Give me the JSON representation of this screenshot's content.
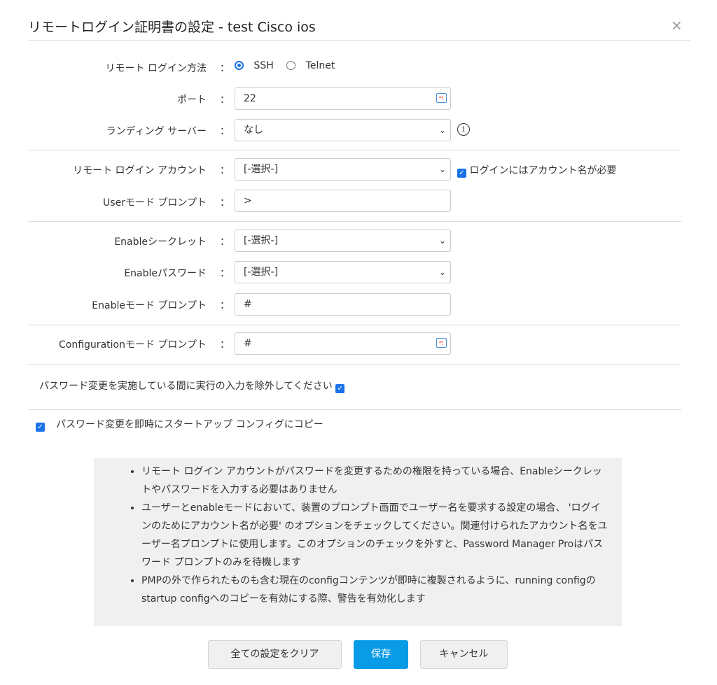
{
  "title": "リモートログイン証明書の設定 - test Cisco ios",
  "close": "×",
  "colon": "：",
  "fields": {
    "login_method": {
      "label": "リモート ログイン方法",
      "options": [
        "SSH",
        "Telnet"
      ],
      "selected": "SSH"
    },
    "port": {
      "label": "ポート",
      "value": "22"
    },
    "landing": {
      "label": "ランディング サーバー",
      "value": "なし"
    },
    "account": {
      "label": "リモート ログイン アカウント",
      "value": "[-選択-]",
      "check_label": "ログインにはアカウント名が必要",
      "checked": true
    },
    "user_prompt": {
      "label": "Userモード プロンプト",
      "value": ">"
    },
    "secret": {
      "label": "Enableシークレット",
      "value": "[-選択-]"
    },
    "enable_pw": {
      "label": "Enableパスワード",
      "value": "[-選択-]"
    },
    "enable_prompt": {
      "label": "Enableモード プロンプト",
      "value": "#"
    },
    "config_prompt": {
      "label": "Configurationモード プロンプト",
      "value": "#"
    }
  },
  "exclude_label": "パスワード変更を実施している間に実行の入力を除外してください",
  "copy_label": "パスワード変更を即時にスタートアップ コンフィグにコピー",
  "notes": [
    "リモート ログイン アカウントがパスワードを変更するための権限を持っている場合、Enableシークレットやパスワードを入力する必要はありません",
    "ユーザーとenableモードにおいて、装置のプロンプト画面でユーザー名を要求する設定の場合、 'ログインのためにアカウント名が必要' のオプションをチェックしてください。関連付けられたアカウント名をユーザー名プロンプトに使用します。このオプションのチェックを外すと、Password Manager Proはパスワード プロンプトのみを待機します",
    "PMPの外で作られたものも含む現在のconfigコンテンツが即時に複製されるように、running configのstartup configへのコピーを有効にする際、警告を有効化します"
  ],
  "buttons": {
    "clear": "全ての設定をクリア",
    "save": "保存",
    "cancel": "キャンセル"
  },
  "colors": {
    "primary": "#0a9be6",
    "check": "#1a73e8"
  }
}
